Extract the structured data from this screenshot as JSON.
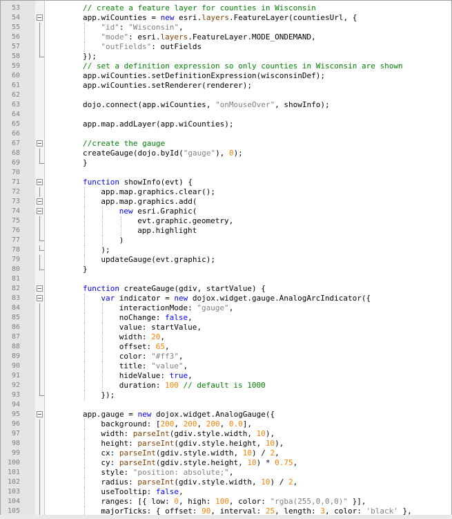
{
  "editor": {
    "lines": [
      {
        "n": "53",
        "indent": 0,
        "fold": "",
        "tokens": [
          [
            "cm",
            "// create a feature layer for counties in Wisconsin"
          ]
        ]
      },
      {
        "n": "54",
        "indent": 0,
        "fold": "open",
        "tokens": [
          [
            "tx",
            "app.wiCounties = "
          ],
          [
            "kw",
            "new"
          ],
          [
            "tx",
            " esri."
          ],
          [
            "fn",
            "layers"
          ],
          [
            "tx",
            ".FeatureLayer(countiesUrl, {"
          ]
        ]
      },
      {
        "n": "55",
        "indent": 1,
        "fold": "body",
        "tokens": [
          [
            "str",
            "\"id\""
          ],
          [
            "tx",
            ": "
          ],
          [
            "str",
            "\"Wisconsin\""
          ],
          [
            "tx",
            ","
          ]
        ]
      },
      {
        "n": "56",
        "indent": 1,
        "fold": "body",
        "tokens": [
          [
            "str",
            "\"mode\""
          ],
          [
            "tx",
            ": esri."
          ],
          [
            "fn",
            "layers"
          ],
          [
            "tx",
            ".FeatureLayer.MODE_ONDEMAND,"
          ]
        ]
      },
      {
        "n": "57",
        "indent": 1,
        "fold": "body",
        "tokens": [
          [
            "str",
            "\"outFields\""
          ],
          [
            "tx",
            ": outFields"
          ]
        ]
      },
      {
        "n": "58",
        "indent": 0,
        "fold": "end",
        "tokens": [
          [
            "tx",
            "});"
          ]
        ]
      },
      {
        "n": "59",
        "indent": 0,
        "fold": "",
        "tokens": [
          [
            "cm",
            "// set a definition expression so only counties in Wisconsin are shown"
          ]
        ]
      },
      {
        "n": "60",
        "indent": 0,
        "fold": "",
        "tokens": [
          [
            "tx",
            "app.wiCounties.setDefinitionExpression(wisconsinDef);"
          ]
        ]
      },
      {
        "n": "61",
        "indent": 0,
        "fold": "",
        "tokens": [
          [
            "tx",
            "app.wiCounties.setRenderer(renderer);"
          ]
        ]
      },
      {
        "n": "62",
        "indent": 0,
        "fold": "",
        "tokens": []
      },
      {
        "n": "63",
        "indent": 0,
        "fold": "",
        "tokens": [
          [
            "tx",
            "dojo.connect(app.wiCounties, "
          ],
          [
            "str",
            "\"onMouseOver\""
          ],
          [
            "tx",
            ", showInfo);"
          ]
        ]
      },
      {
        "n": "64",
        "indent": 0,
        "fold": "",
        "tokens": []
      },
      {
        "n": "65",
        "indent": 0,
        "fold": "",
        "tokens": [
          [
            "tx",
            "app.map.addLayer(app.wiCounties);"
          ]
        ]
      },
      {
        "n": "66",
        "indent": 0,
        "fold": "",
        "tokens": []
      },
      {
        "n": "67",
        "indent": 0,
        "fold": "open",
        "tokens": [
          [
            "cm",
            "//create the gauge"
          ]
        ]
      },
      {
        "n": "68",
        "indent": 0,
        "fold": "body",
        "tokens": [
          [
            "tx",
            "createGauge(dojo.byId("
          ],
          [
            "str",
            "\"gauge\""
          ],
          [
            "tx",
            "), "
          ],
          [
            "num",
            "0"
          ],
          [
            "tx",
            ");"
          ]
        ]
      },
      {
        "n": "69",
        "indent": 0,
        "fold": "end",
        "tokens": [
          [
            "tx",
            "}"
          ]
        ]
      },
      {
        "n": "70",
        "indent": 0,
        "fold": "",
        "tokens": []
      },
      {
        "n": "71",
        "indent": 0,
        "fold": "open",
        "tokens": [
          [
            "kw",
            "function"
          ],
          [
            "tx",
            " showInfo(evt) {"
          ]
        ]
      },
      {
        "n": "72",
        "indent": 1,
        "fold": "body",
        "tokens": [
          [
            "tx",
            "app.map.graphics.clear();"
          ]
        ]
      },
      {
        "n": "73",
        "indent": 1,
        "fold": "open",
        "tokens": [
          [
            "tx",
            "app.map.graphics.add("
          ]
        ]
      },
      {
        "n": "74",
        "indent": 2,
        "fold": "open",
        "tokens": [
          [
            "kw",
            "new"
          ],
          [
            "tx",
            " esri.Graphic("
          ]
        ]
      },
      {
        "n": "75",
        "indent": 3,
        "fold": "body",
        "tokens": [
          [
            "tx",
            "evt.graphic.geometry,"
          ]
        ]
      },
      {
        "n": "76",
        "indent": 3,
        "fold": "body",
        "tokens": [
          [
            "tx",
            "app.highlight"
          ]
        ]
      },
      {
        "n": "77",
        "indent": 2,
        "fold": "end",
        "tokens": [
          [
            "tx",
            ")"
          ]
        ]
      },
      {
        "n": "78",
        "indent": 1,
        "fold": "end",
        "tokens": [
          [
            "tx",
            ");"
          ]
        ]
      },
      {
        "n": "79",
        "indent": 1,
        "fold": "body",
        "tokens": [
          [
            "tx",
            "updateGauge(evt.graphic);"
          ]
        ]
      },
      {
        "n": "80",
        "indent": 0,
        "fold": "end",
        "tokens": [
          [
            "tx",
            "}"
          ]
        ]
      },
      {
        "n": "81",
        "indent": 0,
        "fold": "",
        "tokens": []
      },
      {
        "n": "82",
        "indent": 0,
        "fold": "open",
        "tokens": [
          [
            "kw",
            "function"
          ],
          [
            "tx",
            " createGauge(gdiv, startValue) {"
          ]
        ]
      },
      {
        "n": "83",
        "indent": 1,
        "fold": "open",
        "tokens": [
          [
            "kw",
            "var"
          ],
          [
            "tx",
            " indicator = "
          ],
          [
            "kw",
            "new"
          ],
          [
            "tx",
            " dojox.widget.gauge.AnalogArcIndicator({"
          ]
        ]
      },
      {
        "n": "84",
        "indent": 2,
        "fold": "body",
        "tokens": [
          [
            "tx",
            "interactionMode: "
          ],
          [
            "str",
            "\"gauge\""
          ],
          [
            "tx",
            ","
          ]
        ]
      },
      {
        "n": "85",
        "indent": 2,
        "fold": "body",
        "tokens": [
          [
            "tx",
            "noChange: "
          ],
          [
            "lit",
            "false"
          ],
          [
            "tx",
            ","
          ]
        ]
      },
      {
        "n": "86",
        "indent": 2,
        "fold": "body",
        "tokens": [
          [
            "tx",
            "value: startValue,"
          ]
        ]
      },
      {
        "n": "87",
        "indent": 2,
        "fold": "body",
        "tokens": [
          [
            "tx",
            "width: "
          ],
          [
            "num",
            "20"
          ],
          [
            "tx",
            ","
          ]
        ]
      },
      {
        "n": "88",
        "indent": 2,
        "fold": "body",
        "tokens": [
          [
            "tx",
            "offset: "
          ],
          [
            "num",
            "65"
          ],
          [
            "tx",
            ","
          ]
        ]
      },
      {
        "n": "89",
        "indent": 2,
        "fold": "body",
        "tokens": [
          [
            "tx",
            "color: "
          ],
          [
            "str",
            "\"#ff3\""
          ],
          [
            "tx",
            ","
          ]
        ]
      },
      {
        "n": "90",
        "indent": 2,
        "fold": "body",
        "tokens": [
          [
            "tx",
            "title: "
          ],
          [
            "str",
            "\"value\""
          ],
          [
            "tx",
            ","
          ]
        ]
      },
      {
        "n": "91",
        "indent": 2,
        "fold": "body",
        "tokens": [
          [
            "tx",
            "hideValue: "
          ],
          [
            "lit",
            "true"
          ],
          [
            "tx",
            ","
          ]
        ]
      },
      {
        "n": "92",
        "indent": 2,
        "fold": "body",
        "tokens": [
          [
            "tx",
            "duration: "
          ],
          [
            "num",
            "100"
          ],
          [
            "tx",
            " "
          ],
          [
            "cm",
            "// default is 1000"
          ]
        ]
      },
      {
        "n": "93",
        "indent": 1,
        "fold": "end",
        "tokens": [
          [
            "tx",
            "});"
          ]
        ]
      },
      {
        "n": "94",
        "indent": 0,
        "fold": "",
        "tokens": []
      },
      {
        "n": "95",
        "indent": 0,
        "fold": "open",
        "tokens": [
          [
            "tx",
            "app.gauge = "
          ],
          [
            "kw",
            "new"
          ],
          [
            "tx",
            " dojox.widget.AnalogGauge({"
          ]
        ]
      },
      {
        "n": "96",
        "indent": 1,
        "fold": "body",
        "tokens": [
          [
            "tx",
            "background: ["
          ],
          [
            "num",
            "200"
          ],
          [
            "tx",
            ", "
          ],
          [
            "num",
            "200"
          ],
          [
            "tx",
            ", "
          ],
          [
            "num",
            "200"
          ],
          [
            "tx",
            ", "
          ],
          [
            "num",
            "0.0"
          ],
          [
            "tx",
            "],"
          ]
        ]
      },
      {
        "n": "97",
        "indent": 1,
        "fold": "body",
        "tokens": [
          [
            "tx",
            "width: "
          ],
          [
            "fn",
            "parseInt"
          ],
          [
            "tx",
            "(gdiv.style.width, "
          ],
          [
            "num",
            "10"
          ],
          [
            "tx",
            "),"
          ]
        ]
      },
      {
        "n": "98",
        "indent": 1,
        "fold": "body",
        "tokens": [
          [
            "tx",
            "height: "
          ],
          [
            "fn",
            "parseInt"
          ],
          [
            "tx",
            "(gdiv.style.height, "
          ],
          [
            "num",
            "10"
          ],
          [
            "tx",
            "),"
          ]
        ]
      },
      {
        "n": "99",
        "indent": 1,
        "fold": "body",
        "tokens": [
          [
            "tx",
            "cx: "
          ],
          [
            "fn",
            "parseInt"
          ],
          [
            "tx",
            "(gdiv.style.width, "
          ],
          [
            "num",
            "10"
          ],
          [
            "tx",
            ") / "
          ],
          [
            "num",
            "2"
          ],
          [
            "tx",
            ","
          ]
        ]
      },
      {
        "n": "100",
        "indent": 1,
        "fold": "body",
        "tokens": [
          [
            "tx",
            "cy: "
          ],
          [
            "fn",
            "parseInt"
          ],
          [
            "tx",
            "(gdiv.style.height, "
          ],
          [
            "num",
            "10"
          ],
          [
            "tx",
            ") * "
          ],
          [
            "num",
            "0.75"
          ],
          [
            "tx",
            ","
          ]
        ]
      },
      {
        "n": "101",
        "indent": 1,
        "fold": "body",
        "tokens": [
          [
            "tx",
            "style: "
          ],
          [
            "str",
            "\"position: absolute;\""
          ],
          [
            "tx",
            ","
          ]
        ]
      },
      {
        "n": "102",
        "indent": 1,
        "fold": "body",
        "tokens": [
          [
            "tx",
            "radius: "
          ],
          [
            "fn",
            "parseInt"
          ],
          [
            "tx",
            "(gdiv.style.width, "
          ],
          [
            "num",
            "10"
          ],
          [
            "tx",
            ") / "
          ],
          [
            "num",
            "2"
          ],
          [
            "tx",
            ","
          ]
        ]
      },
      {
        "n": "103",
        "indent": 1,
        "fold": "body",
        "tokens": [
          [
            "tx",
            "useTooltip: "
          ],
          [
            "lit",
            "false"
          ],
          [
            "tx",
            ","
          ]
        ]
      },
      {
        "n": "104",
        "indent": 1,
        "fold": "body",
        "tokens": [
          [
            "tx",
            "ranges: [{ low: "
          ],
          [
            "num",
            "0"
          ],
          [
            "tx",
            ", high: "
          ],
          [
            "num",
            "100"
          ],
          [
            "tx",
            ", color: "
          ],
          [
            "str",
            "\"rgba(255,0,0,0)\""
          ],
          [
            "tx",
            " }],"
          ]
        ]
      },
      {
        "n": "105",
        "indent": 1,
        "fold": "body",
        "tokens": [
          [
            "tx",
            "majorTicks: { offset: "
          ],
          [
            "num",
            "90"
          ],
          [
            "tx",
            ", interval: "
          ],
          [
            "num",
            "25"
          ],
          [
            "tx",
            ", length: "
          ],
          [
            "num",
            "3"
          ],
          [
            "tx",
            ", color: "
          ],
          [
            "str",
            "'black'"
          ],
          [
            "tx",
            " },"
          ]
        ]
      }
    ]
  }
}
